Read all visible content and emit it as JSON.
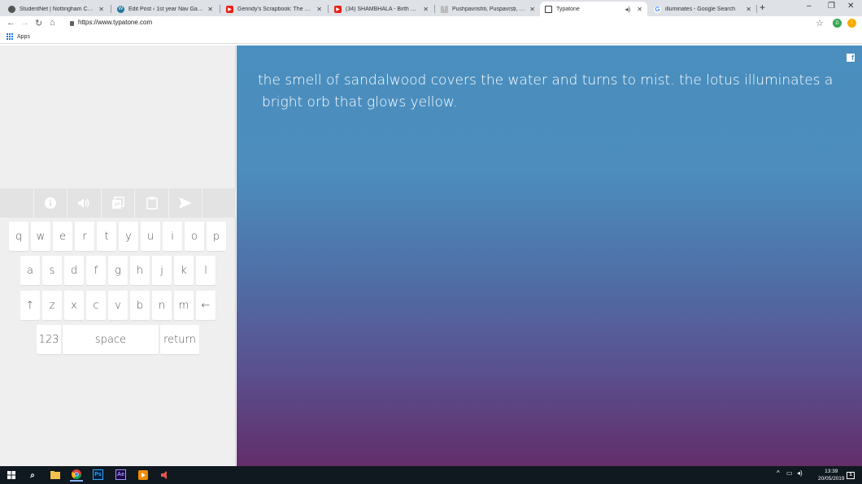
{
  "browser": {
    "tabs": [
      {
        "title": "StudentNet | Nottingham College",
        "icon": "studentnet-icon"
      },
      {
        "title": "Edit Post ‹ 1st year Nav Game Design",
        "icon": "wordpress-icon"
      },
      {
        "title": "Genndy's Scrapbook: The Story of",
        "icon": "youtube-icon"
      },
      {
        "title": "(34) SHAMBHALA - Birth Place of",
        "icon": "youtube-icon"
      },
      {
        "title": "Pushpavrishti, Puspavṛṣṭi, Pushpa",
        "icon": "typatone-icon"
      },
      {
        "title": "Typatone",
        "icon": "typatone-icon"
      },
      {
        "title": "illuminates - Google Search",
        "icon": "google-icon"
      }
    ],
    "url": "https://www.typatone.com",
    "bookmarks_apps_label": "Apps",
    "profile_initial": "D",
    "update_badge": "!"
  },
  "keyboard": {
    "toolbar": [
      "info-icon",
      "sound-icon",
      "pattern-icon",
      "clipboard-icon",
      "send-icon"
    ],
    "row1": [
      "q",
      "w",
      "e",
      "r",
      "t",
      "y",
      "u",
      "i",
      "o",
      "p"
    ],
    "row2": [
      "a",
      "s",
      "d",
      "f",
      "g",
      "h",
      "j",
      "k",
      "l"
    ],
    "row3": [
      "↑",
      "z",
      "x",
      "c",
      "v",
      "b",
      "n",
      "m",
      "←"
    ],
    "row4": [
      "123",
      "space",
      "return"
    ]
  },
  "stage": {
    "text_line1": "the smell of sandalwood covers the water and turns to mist. the lotus illuminates a",
    "text_line2": "bright orb that glows yellow.",
    "share_icon": "f"
  },
  "taskbar": {
    "time": "13:39",
    "date": "20/05/2019",
    "notification_count": "1"
  },
  "colors": {
    "stage_top": "#4a8fbf",
    "stage_bottom": "#622e6a",
    "panel_bg": "#efefef"
  }
}
